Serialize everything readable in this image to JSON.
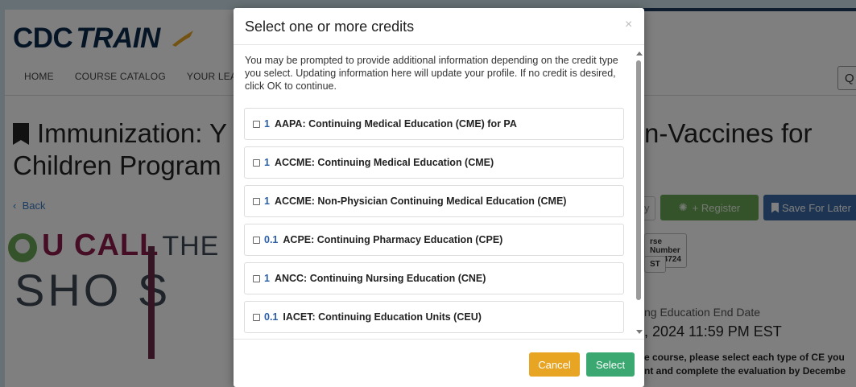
{
  "page": {
    "logo_cdc": "CDC",
    "logo_train": "TRAIN",
    "nav": [
      "HOME",
      "COURSE CATALOG",
      "YOUR LEA"
    ],
    "search_icon_glyph": "Q",
    "title_left_line1": "Immunization: Y",
    "title_left_line2": "Children Program",
    "title_right": "n-Vaccines for",
    "back_label": "Back",
    "you_call_the_shots": {
      "line1": "U CALL",
      "the": "THE",
      "line2": "SHO  S"
    },
    "ghost_button": "y",
    "register_label": "+ Register",
    "save_later_label": "Save For Later",
    "course_number_tag": "rse Number WB4724",
    "timezone_tag": "ST",
    "end_date_label": "ng Education End Date",
    "end_date_value": ", 2024 11:59 PM EST",
    "note_line1": "e course, please select each type of CE you",
    "note_line2": "nt and complete the evaluation by Decembe"
  },
  "modal": {
    "title": "Select one or more credits",
    "close_glyph": "×",
    "intro": "You may be prompted to provide additional information depending on the credit type you select. Updating information here will update your profile. If no credit is desired, click OK to continue.",
    "credits": [
      {
        "amount": "1",
        "name": "AAPA: Continuing Medical Education (CME) for PA"
      },
      {
        "amount": "1",
        "name": "ACCME: Continuing Medical Education (CME)"
      },
      {
        "amount": "1",
        "name": "ACCME: Non-Physician Continuing Medical Education (CME)"
      },
      {
        "amount": "0.1",
        "name": "ACPE: Continuing Pharmacy Education (CPE)"
      },
      {
        "amount": "1",
        "name": "ANCC: Continuing Nursing Education (CNE)"
      },
      {
        "amount": "0.1",
        "name": "IACET: Continuing Education Units (CEU)"
      }
    ],
    "cancel_label": "Cancel",
    "select_label": "Select"
  },
  "colors": {
    "amount_blue": "#2b5ea8",
    "cancel_orange": "#e8a524",
    "select_green": "#3aa870",
    "register_green": "#6aa657",
    "save_blue": "#3b6aa6",
    "logo_navy": "#0b2a4a"
  }
}
